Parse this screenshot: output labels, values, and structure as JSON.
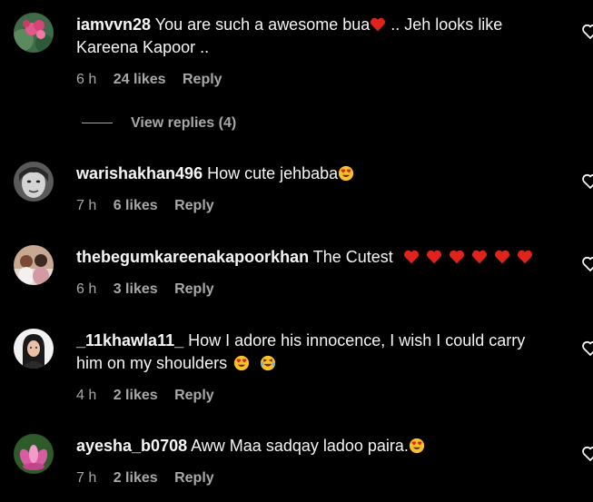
{
  "comments": [
    {
      "username": "iamvvn28",
      "text_lines": [
        "You are such a awesome bua",
        ".. Jeh looks like",
        "Kareena Kapoor .."
      ],
      "emojis": [
        "red-heart"
      ],
      "time": "6 h",
      "likes": "24 likes",
      "reply": "Reply",
      "avatar": "flower-avatar-pink"
    },
    {
      "username": "warishakhan496",
      "text": "How cute jehbaba",
      "emojis": [
        "heart-eyes"
      ],
      "time": "7 h",
      "likes": "6 likes",
      "reply": "Reply",
      "avatar": "portrait-avatar-bw"
    },
    {
      "username": "thebegumkareenakapoorkhan",
      "text": "The Cutest",
      "emojis": [
        "red-heart",
        "red-heart",
        "red-heart",
        "red-heart",
        "red-heart",
        "red-heart"
      ],
      "time": "6 h",
      "likes": "3 likes",
      "reply": "Reply",
      "avatar": "group-photo-avatar"
    },
    {
      "username": "_11khawla11_",
      "text_lines": [
        "How I adore his innocence, I wish I could carry",
        "him on my shoulders"
      ],
      "emojis": [
        "heart-eyes",
        "laughing-tears"
      ],
      "time": "4 h",
      "likes": "2 likes",
      "reply": "Reply",
      "avatar": "cartoon-girl-avatar"
    },
    {
      "username": "ayesha_b0708",
      "text": "Aww Maa sadqay ladoo paira.",
      "emojis": [
        "heart-eyes"
      ],
      "time": "7 h",
      "likes": "2 likes",
      "reply": "Reply",
      "avatar": "lotus-avatar"
    }
  ],
  "view_replies": "View replies (4)",
  "colors": {
    "background": "#000000",
    "text": "#f5f5f5",
    "secondary": "#a8a8a8",
    "heart": "#e0241b"
  },
  "icons": {
    "like_button": "heart-outline-icon"
  }
}
